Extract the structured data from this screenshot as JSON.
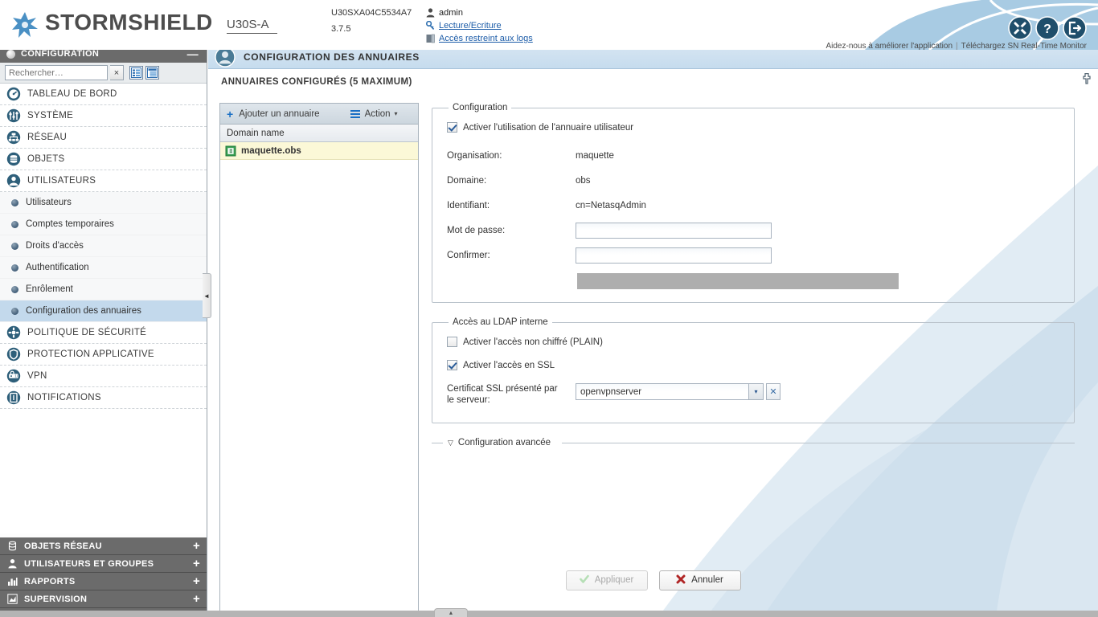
{
  "header": {
    "brand": "STORMSHIELD",
    "model": "U30S-A",
    "serial": "U30SXA04C5534A7",
    "firmware": "3.7.5",
    "user_name": "admin",
    "access_mode": "Lecture/Ecriture",
    "log_access": "Accès restreint aux logs",
    "tagline_improve": "Aidez-nous à améliorer l'application",
    "tagline_sep": "|",
    "tagline_download": "Téléchargez SN Real-Time Monitor",
    "icon_tools": "tools-icon",
    "icon_help": "help-icon",
    "icon_logout": "logout-icon",
    "icon_user": "user-icon",
    "icon_key": "key-icon",
    "icon_logs": "logs-icon"
  },
  "sidebar": {
    "title": "CONFIGURATION",
    "minimize": "—",
    "collapse": "«",
    "search_placeholder": "Rechercher…",
    "search_value": "",
    "search_clear": "×",
    "view_icon_1": "list-view-icon",
    "view_icon_2": "tree-view-icon",
    "top_items": [
      {
        "label": "TABLEAU DE BORD",
        "icon": "dashboard-icon"
      },
      {
        "label": "SYSTÈME",
        "icon": "system-icon"
      },
      {
        "label": "RÉSEAU",
        "icon": "network-icon"
      },
      {
        "label": "OBJETS",
        "icon": "objects-icon"
      },
      {
        "label": "UTILISATEURS",
        "icon": "users-icon"
      }
    ],
    "sub_items": [
      {
        "label": "Utilisateurs",
        "active": false
      },
      {
        "label": "Comptes temporaires",
        "active": false
      },
      {
        "label": "Droits d'accès",
        "active": false
      },
      {
        "label": "Authentification",
        "active": false
      },
      {
        "label": "Enrôlement",
        "active": false
      },
      {
        "label": "Configuration des annuaires",
        "active": true
      }
    ],
    "top_items_2": [
      {
        "label": "POLITIQUE DE SÉCURITÉ",
        "icon": "shield-policy-icon"
      },
      {
        "label": "PROTECTION APPLICATIVE",
        "icon": "app-protection-icon"
      },
      {
        "label": "VPN",
        "icon": "vpn-icon"
      },
      {
        "label": "NOTIFICATIONS",
        "icon": "notifications-icon"
      }
    ],
    "bottom_groups": [
      {
        "label": "OBJETS RÉSEAU",
        "icon": "db-icon",
        "expander": "+"
      },
      {
        "label": "UTILISATEURS ET GROUPES",
        "icon": "person-icon",
        "expander": "+"
      },
      {
        "label": "RAPPORTS",
        "icon": "bars-icon",
        "expander": "+"
      },
      {
        "label": "SUPERVISION",
        "icon": "chart-icon",
        "expander": "+"
      }
    ],
    "handle": "◄"
  },
  "page": {
    "title": "CONFIGURATION DES ANNUAIRES",
    "title_icon": "directory-user-icon",
    "pin_icon": "pin-icon",
    "section_label": "ANNUAIRES CONFIGURÉS (5 MAXIMUM)"
  },
  "directory_panel": {
    "add_label": "Ajouter un annuaire",
    "add_icon": "plus-icon",
    "action_label": "Action",
    "action_icon": "menu-icon",
    "action_caret": "▾",
    "column_header": "Domain name",
    "rows": [
      {
        "name": "maquette.obs",
        "icon": "directory-entry-icon",
        "selected": true
      }
    ]
  },
  "configuration": {
    "legend": "Configuration",
    "enable_checkbox_label": "Activer l'utilisation de l'annuaire utilisateur",
    "enable_checkbox_checked": true,
    "fields": [
      {
        "label": "Organisation:",
        "value": "maquette"
      },
      {
        "label": "Domaine:",
        "value": "obs"
      },
      {
        "label": "Identifiant:",
        "value": "cn=NetasqAdmin"
      }
    ],
    "password_label": "Mot de passe:",
    "password_value": "",
    "confirm_label": "Confirmer:",
    "confirm_value": ""
  },
  "ldap": {
    "legend": "Accès au LDAP interne",
    "plain_label": "Activer l'accès non chiffré (PLAIN)",
    "plain_checked": false,
    "ssl_label": "Activer l'accès en SSL",
    "ssl_checked": true,
    "cert_label_line1": "Certificat SSL présenté par",
    "cert_label_line2": "le serveur:",
    "cert_value": "openvpnserver",
    "cert_caret": "▾",
    "cert_clear": "✕"
  },
  "advanced": {
    "label": "Configuration avancée",
    "triangle": "▽"
  },
  "footer": {
    "apply_label": "Appliquer",
    "apply_icon": "check-icon",
    "apply_disabled": true,
    "cancel_label": "Annuler",
    "cancel_icon": "cross-icon",
    "tab_icon": "▲"
  },
  "colors": {
    "accent_blue": "#1a6fc4",
    "header_blue": "#a8cbe3",
    "title_bar": "#c6dcee",
    "sidebar_dark": "#6b6b6b",
    "active_row": "#c3d9ec",
    "selected_row": "#fbf8d7",
    "icon_teal": "#2e5f7a"
  }
}
